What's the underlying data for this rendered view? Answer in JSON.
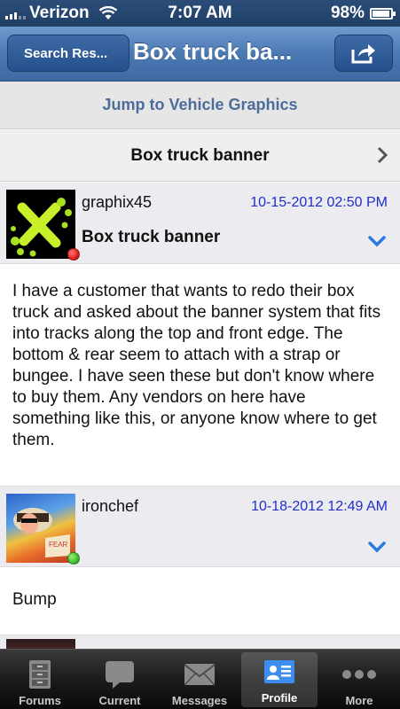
{
  "status_bar": {
    "carrier": "Verizon",
    "time": "7:07 AM",
    "battery": "98%"
  },
  "nav": {
    "back_label": "Search Res...",
    "title": "Box truck ba..."
  },
  "jump_link": "Jump to Vehicle Graphics",
  "thread_title": "Box truck banner",
  "posts": [
    {
      "author": "graphix45",
      "date": "10-15-2012 02:50 PM",
      "title": "Box truck banner",
      "status_color": "#e0201e",
      "body": "I have a customer that wants to redo their box truck and asked about the banner system that fits into tracks along the top and front edge. The bottom & rear seem to attach with a strap or bungee. I have seen these but don't know where to buy them. Any vendors on here have something like this, or anyone know where to get them."
    },
    {
      "author": "ironchef",
      "date": "10-18-2012 12:49 AM",
      "title": "",
      "status_color": "#3fbf2a",
      "body": "Bump"
    }
  ],
  "tabs": [
    {
      "label": "Forums",
      "icon": "forums-icon"
    },
    {
      "label": "Current",
      "icon": "current-icon"
    },
    {
      "label": "Messages",
      "icon": "messages-icon"
    },
    {
      "label": "Profile",
      "icon": "profile-icon",
      "active": true
    },
    {
      "label": "More",
      "icon": "more-icon"
    }
  ],
  "colors": {
    "accent": "#4b79b3",
    "date": "#1f2ecc",
    "link": "#4c6d9a"
  }
}
